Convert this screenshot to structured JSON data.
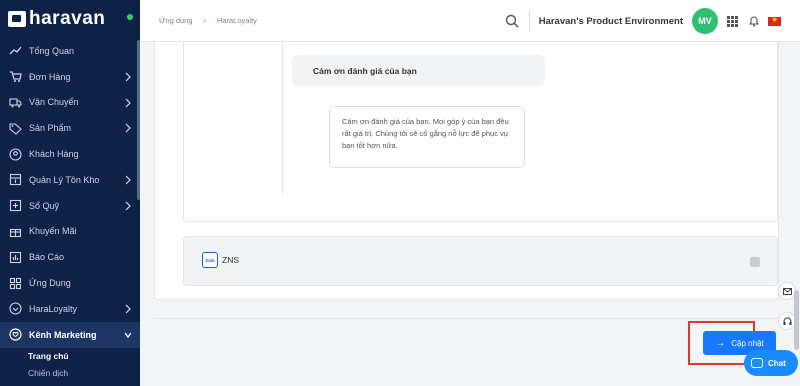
{
  "app": {
    "brand": "haravan"
  },
  "sidebar": {
    "items": [
      {
        "label": "Tổng Quan",
        "icon": "chart-line-icon",
        "chevron": false
      },
      {
        "label": "Đơn Hàng",
        "icon": "cart-icon",
        "chevron": true
      },
      {
        "label": "Vận Chuyển",
        "icon": "truck-icon",
        "chevron": true
      },
      {
        "label": "Sản Phẩm",
        "icon": "tag-icon",
        "chevron": true
      },
      {
        "label": "Khách Hàng",
        "icon": "user-circle-icon",
        "chevron": false
      },
      {
        "label": "Quản Lý Tồn Kho",
        "icon": "inventory-icon",
        "chevron": true
      },
      {
        "label": "Sổ Quỹ",
        "icon": "ledger-icon",
        "chevron": true
      },
      {
        "label": "Khuyến Mãi",
        "icon": "gift-icon",
        "chevron": false
      },
      {
        "label": "Báo Cáo",
        "icon": "report-icon",
        "chevron": false
      },
      {
        "label": "Ứng Dụng",
        "icon": "apps-icon",
        "chevron": false
      },
      {
        "label": "HaraLoyalty",
        "icon": "loyalty-icon",
        "chevron": true
      },
      {
        "label": "Kênh Marketing",
        "icon": "marketing-icon",
        "chevron": true,
        "active": true
      }
    ],
    "subitems": [
      {
        "label": "Trang chủ",
        "active": true
      },
      {
        "label": "Chiến dịch",
        "active": false
      }
    ]
  },
  "topbar": {
    "breadcrumb": [
      "Ứng dụng",
      "HaraLoyalty"
    ],
    "environment": "Haravan's Product Environment",
    "avatar_initials": "MV"
  },
  "content": {
    "bubble_title": "Cảm ơn đánh giá của bạn",
    "bubble_body": "Cảm ơn đánh giá của bạn. Mọi góp ý của bạn đều rất giá trị. Chúng tôi sẽ cố gắng nỗ lực để phục vụ bạn tốt hơn nữa.",
    "zns_icon_text": "Zalo",
    "zns_label": "ZNS",
    "update_button": "Cập nhật"
  },
  "chat": {
    "label": "Chat"
  },
  "colors": {
    "sidebar_bg": "#0e2247",
    "primary": "#1677ff",
    "avatar": "#2fbf71",
    "highlight": "#e0392c"
  }
}
